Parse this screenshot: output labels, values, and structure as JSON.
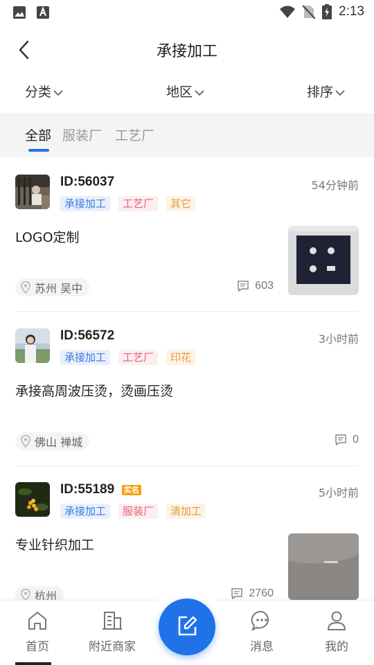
{
  "status_bar": {
    "time": "2:13",
    "notification_icons": [
      "image-icon",
      "a-icon"
    ]
  },
  "header": {
    "title": "承接加工"
  },
  "filters": [
    {
      "label": "分类"
    },
    {
      "label": "地区"
    },
    {
      "label": "排序"
    }
  ],
  "tabs": [
    {
      "label": "全部",
      "active": true
    },
    {
      "label": "服装厂",
      "active": false
    },
    {
      "label": "工艺厂",
      "active": false
    }
  ],
  "posts": [
    {
      "id": "ID:56037",
      "time": "54分钟前",
      "tags": [
        "承接加工",
        "工艺厂",
        "其它"
      ],
      "title": "LOGO定制",
      "location": "苏州 吴中",
      "comments": "603",
      "has_thumbnail": true
    },
    {
      "id": "ID:56572",
      "time": "3小时前",
      "tags": [
        "承接加工",
        "工艺厂",
        "印花"
      ],
      "title": "承接高周波压烫，烫画压烫",
      "location": "佛山 禅城",
      "comments": "0",
      "has_thumbnail": false
    },
    {
      "id": "ID:55189",
      "badge": "实名",
      "time": "5小时前",
      "tags": [
        "承接加工",
        "服装厂",
        "清加工"
      ],
      "title": "专业针织加工",
      "location": "杭州",
      "comments": "2760",
      "has_thumbnail": true
    }
  ],
  "bottom_nav": [
    {
      "label": "首页",
      "icon": "home-icon"
    },
    {
      "label": "附近商家",
      "icon": "building-icon"
    },
    {
      "label": "",
      "icon": "edit-icon"
    },
    {
      "label": "消息",
      "icon": "message-icon"
    },
    {
      "label": "我的",
      "icon": "user-icon"
    }
  ],
  "colors": {
    "accent": "#1f72e8",
    "tag_blue": "#3d7ae0",
    "tag_pink": "#e6607a",
    "tag_orange": "#e59b3b",
    "badge": "#f3a313"
  }
}
